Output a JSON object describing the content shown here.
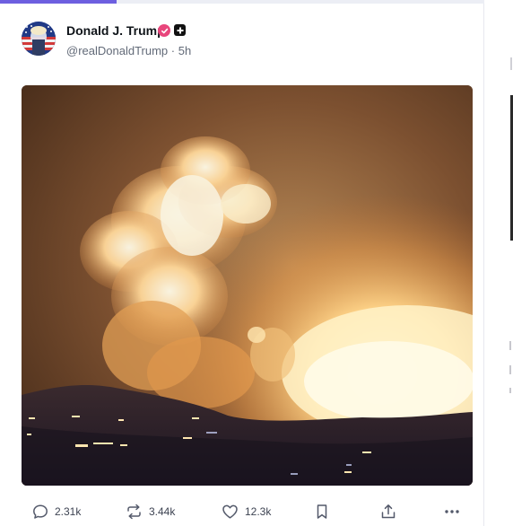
{
  "progress": {
    "fraction": 0.24,
    "color": "#6d5fe0"
  },
  "post": {
    "author_name": "Donald J. Trump",
    "handle": "@realDonaldTrump",
    "separator": "·",
    "time": "5h",
    "verified_color": "#e8467c",
    "avatar_icon": "flag-portrait-avatar",
    "media_alt_icon": "explosion-night-scene"
  },
  "actions": {
    "reply_count": "2.31k",
    "repost_count": "3.44k",
    "like_count": "12.3k"
  }
}
